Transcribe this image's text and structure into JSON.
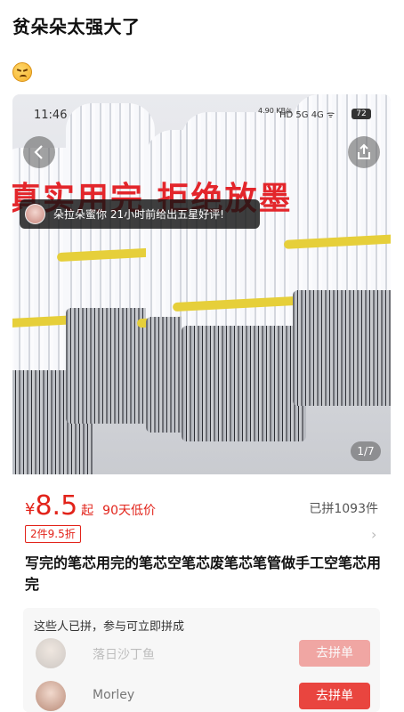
{
  "post": {
    "title": "贫朵朵太强大了",
    "emoji": "angry-face-emoji"
  },
  "status_bar": {
    "time": "11:46",
    "network": "4.90 KB/s",
    "icons": "HD 5G 4G ᯤ",
    "battery": "72"
  },
  "banner": {
    "text": "真实用完 拒绝放墨"
  },
  "toast": {
    "text": "朵拉朵蜜你 21小时前给出五星好评!"
  },
  "gallery": {
    "indicator": "1/7"
  },
  "product": {
    "currency": "¥",
    "price": "8.5",
    "price_suffix": "起",
    "low_label": "90天低价",
    "sold": "已拼1093件",
    "discount": "2件9.5折",
    "title": "写完的笔芯用完的笔芯空笔芯废笔芯笔管做手工空笔芯用完"
  },
  "group_buy": {
    "header": "这些人已拼，参与可立即拼成",
    "members": [
      {
        "name": "落日沙丁鱼",
        "button": "去拼单"
      },
      {
        "name": "Morley",
        "button": "去拼单"
      }
    ]
  },
  "colors": {
    "accent": "#e2231a",
    "banner": "#e3262b",
    "band": "#e6cf3a"
  }
}
